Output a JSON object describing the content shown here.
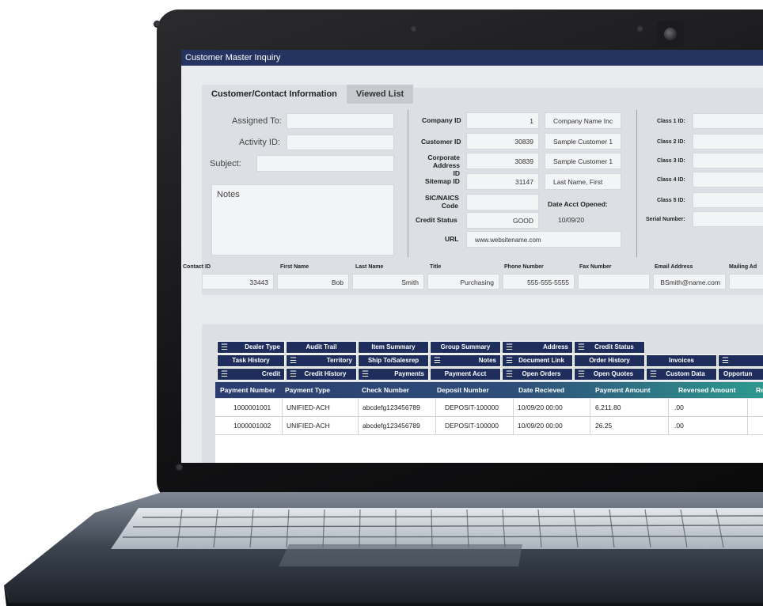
{
  "window": {
    "title": "Customer Master Inquiry"
  },
  "tabs": [
    {
      "label": "Customer/Contact Information",
      "active": true
    },
    {
      "label": "Viewed List",
      "active": false
    }
  ],
  "left": {
    "assigned_to": {
      "label": "Assigned To:",
      "value": ""
    },
    "activity_id": {
      "label": "Activity ID:",
      "value": ""
    },
    "subject": {
      "label": "Subject:",
      "value": ""
    },
    "notes": {
      "label": "Notes",
      "value": ""
    }
  },
  "company": {
    "company_id": {
      "label": "Company ID",
      "value": "1",
      "extra": "Company Name Inc"
    },
    "customer_id": {
      "label": "Customer ID",
      "value": "30839",
      "extra": "Sample Customer 1"
    },
    "corporate_address_id": {
      "label1": "Corporate",
      "label2": "Address ID",
      "value": "30839",
      "extra": "Sample Customer 1"
    },
    "sitemap_id": {
      "label": "Sitemap ID",
      "value": "31147",
      "extra": "Last Name, First"
    },
    "sic_naics": {
      "label1": "SIC/NAICS",
      "label2": "Code",
      "value": "",
      "extra_label": "Date Acct Opened:"
    },
    "credit_status": {
      "label": "Credit Status",
      "value": "GOOD",
      "extra": "10/09/20"
    },
    "url": {
      "label": "URL",
      "value": "www.websitename.com"
    }
  },
  "classes": {
    "class1": "Class 1 ID:",
    "class2": "Class 2 ID:",
    "class3": "Class 3 ID:",
    "class4": "Class 4 ID:",
    "class5": "Class 5 ID:",
    "serial": "Serial Number:"
  },
  "contact": {
    "headers": [
      "Contact ID",
      "First Name",
      "Last Name",
      "Title",
      "Phone Number",
      "Fax Number",
      "Email Address",
      "Mailing Ad"
    ],
    "values": {
      "contact_id": "33443",
      "first_name": "Bob",
      "last_name": "Smith",
      "title": "Purchasing",
      "phone": "555-555-5555",
      "fax": "",
      "email": "BSmith@name.com",
      "mailing": ""
    }
  },
  "buttons": {
    "dealer_type": "Dealer Type",
    "audit_trail": "Audit Trail",
    "item_summary": "Item Summary",
    "group_summary": "Group Summary",
    "address": "Address",
    "credit_status": "Credit Status",
    "task_history": "Task History",
    "territory": "Territory",
    "ship_to_salesrep": "Ship To/Salesrep",
    "notes": "Notes",
    "document_link": "Document Link",
    "order_history": "Order History",
    "invoices": "Invoices",
    "credit": "Credit",
    "credit_history": "Credit History",
    "payments": "Payments",
    "payment_acct": "Payment Acct",
    "open_orders": "Open Orders",
    "open_quotes": "Open Quotes",
    "custom_data": "Custom Data",
    "opportun": "Opportun"
  },
  "payments_table": {
    "columns": [
      "Payment Number",
      "Payment Type",
      "Check Number",
      "Deposit Number",
      "Date Recieved",
      "Payment Amount",
      "Reversed Amount",
      "Re"
    ],
    "rows": [
      [
        "1000001001",
        "UNIFIED-ACH",
        "abcdefg123456789",
        "DEPOSIT-100000",
        "10/09/20 00:00",
        "6,211.80",
        ".00",
        ""
      ],
      [
        "1000001002",
        "UNIFIED-ACH",
        "abcdefg123456789",
        "DEPOSIT-100000",
        "10/09/20 00:00",
        "26.25",
        ".00",
        ""
      ]
    ]
  },
  "icons": {
    "list": "list-icon"
  }
}
